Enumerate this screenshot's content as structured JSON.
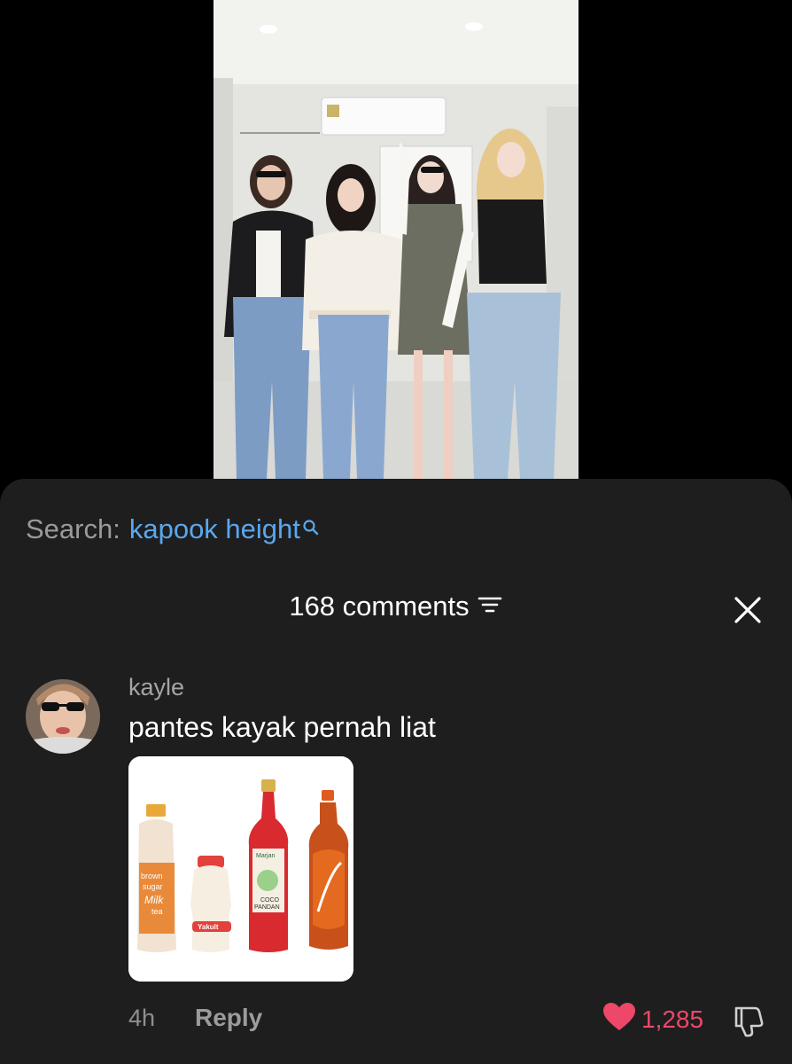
{
  "search": {
    "label": "Search:",
    "term": "kapook height"
  },
  "comments_header": {
    "count_label": "168 comments"
  },
  "comment": {
    "username": "kayle",
    "text": "pantes kayak pernah liat",
    "time": "4h",
    "reply_label": "Reply",
    "likes": "1,285",
    "image_labels": {
      "yakult": "Yakult",
      "marjan": "Marjan",
      "coco": "COCO",
      "pandan": "PANDAN",
      "brown": "brown",
      "sugar": "sugar",
      "milk": "Milk",
      "tea": "tea"
    }
  },
  "colors": {
    "sheet_bg": "#1e1e1e",
    "accent_link": "#5aa7ef",
    "like_red": "#ef4767"
  },
  "icons": [
    "search-icon",
    "filter-icon",
    "close-icon",
    "heart-icon",
    "dislike-icon"
  ]
}
